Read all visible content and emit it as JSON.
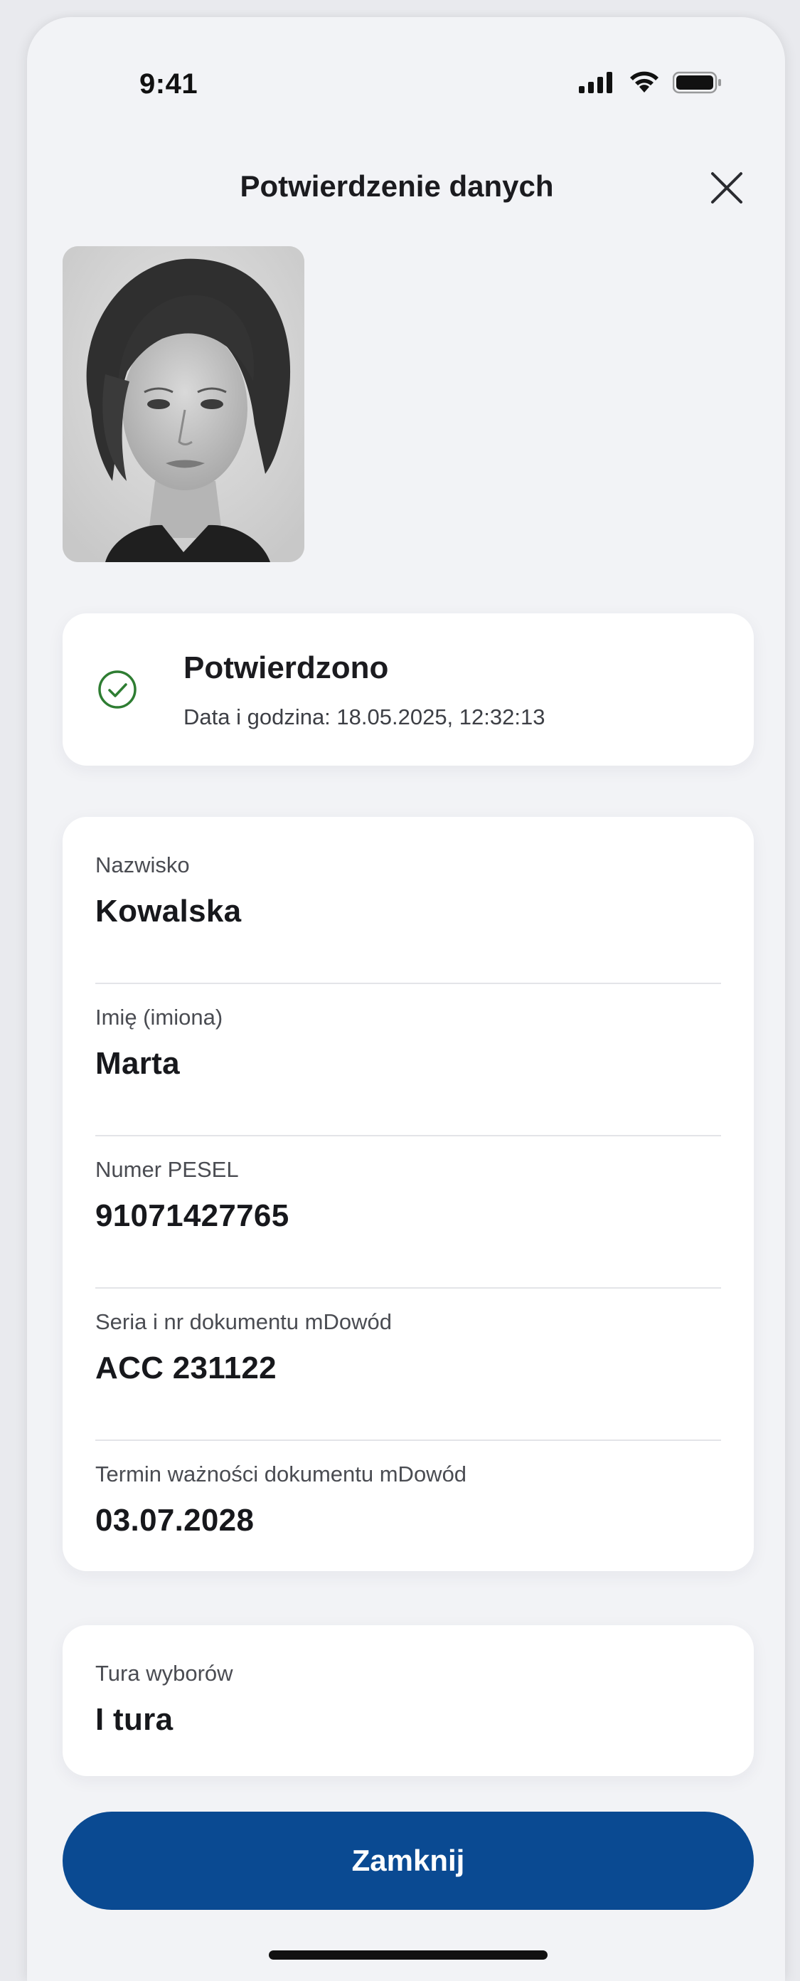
{
  "status_bar": {
    "time": "9:41"
  },
  "header": {
    "title": "Potwierdzenie danych",
    "close_icon": "close-icon"
  },
  "photo": {
    "description_icon": "portrait-photo"
  },
  "confirmation": {
    "icon": "check-circle-icon",
    "title": "Potwierdzono",
    "subtitle": "Data i godzina: 18.05.2025, 12:32:13",
    "accent_color": "#2e7d32"
  },
  "details": [
    {
      "label": "Nazwisko",
      "value": "Kowalska"
    },
    {
      "label": "Imię (imiona)",
      "value": "Marta"
    },
    {
      "label": "Numer PESEL",
      "value": "91071427765"
    },
    {
      "label": "Seria i nr dokumentu mDowód",
      "value": "ACC 231122"
    },
    {
      "label": "Termin ważności dokumentu mDowód",
      "value": "03.07.2028"
    }
  ],
  "election_round": {
    "label": "Tura wyborów",
    "value": "I tura"
  },
  "actions": {
    "close_label": "Zamknij",
    "primary_color": "#0a4a92"
  }
}
